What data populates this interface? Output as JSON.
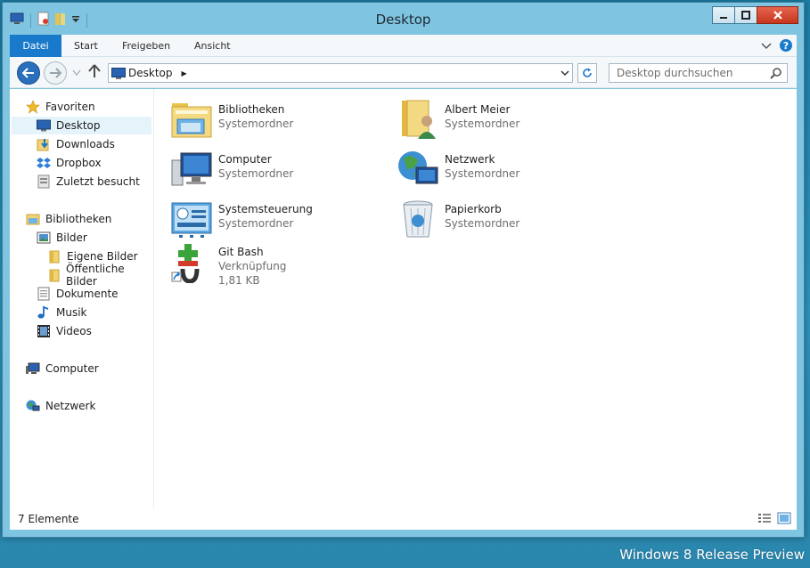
{
  "window": {
    "title": "Desktop"
  },
  "ribbon": {
    "tabs": [
      {
        "label": "Datei"
      },
      {
        "label": "Start"
      },
      {
        "label": "Freigeben"
      },
      {
        "label": "Ansicht"
      }
    ]
  },
  "address": {
    "crumb": "Desktop"
  },
  "search": {
    "placeholder": "Desktop durchsuchen"
  },
  "nav": {
    "favorites": "Favoriten",
    "desktop": "Desktop",
    "downloads": "Downloads",
    "dropbox": "Dropbox",
    "recent": "Zuletzt besucht",
    "libraries": "Bibliotheken",
    "pictures": "Bilder",
    "my_pictures": "Eigene Bilder",
    "public_pictures": "Öffentliche Bilder",
    "documents": "Dokumente",
    "music": "Musik",
    "videos": "Videos",
    "computer": "Computer",
    "network": "Netzwerk"
  },
  "items": [
    {
      "name": "Bibliotheken",
      "sub": "Systemordner"
    },
    {
      "name": "Albert Meier",
      "sub": "Systemordner"
    },
    {
      "name": "Computer",
      "sub": "Systemordner"
    },
    {
      "name": "Netzwerk",
      "sub": "Systemordner"
    },
    {
      "name": "Systemsteuerung",
      "sub": "Systemordner"
    },
    {
      "name": "Papierkorb",
      "sub": "Systemordner"
    },
    {
      "name": "Git Bash",
      "sub": "Verknüpfung",
      "size": "1,81 KB"
    }
  ],
  "status": {
    "count": "7 Elemente"
  },
  "watermark": "Windows 8 Release Preview",
  "colors": {
    "accent": "#1979ca",
    "selection": "#e5f3fb",
    "frame": "#7fc4e0"
  }
}
